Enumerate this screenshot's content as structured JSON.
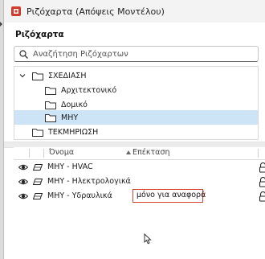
{
  "window": {
    "title": "Ριζόχαρτα (Απόψεις Μοντέλου)"
  },
  "panel": {
    "section_title": "Ριζόχαρτα"
  },
  "search": {
    "placeholder": "Αναζήτηση Ριζόχαρτων",
    "value": ""
  },
  "tree": {
    "items": [
      {
        "label": "ΣΧΕΔΙΑΣΗ",
        "expanded": true,
        "level": 0
      },
      {
        "label": "Αρχιτεκτονικό",
        "level": 1
      },
      {
        "label": "Δομικό",
        "level": 1
      },
      {
        "label": "ΜΗΥ",
        "level": 1,
        "selected": true
      },
      {
        "label": "ΤΕΚΜΗΡΙΩΣΗ",
        "level": 0
      }
    ]
  },
  "layers_table": {
    "columns": {
      "name": "Όνομα",
      "extension": "Επέκταση"
    },
    "rows": [
      {
        "name": "ΜΗΥ - HVAC",
        "extension": ""
      },
      {
        "name": "ΜΗΥ - Ηλεκτρολογικά",
        "extension": ""
      },
      {
        "name": "ΜΗΥ - Υδραυλικά",
        "extension": "μόνο για αναφορά"
      }
    ]
  },
  "icons": [
    "app-icon",
    "search-icon",
    "chevron-down-icon",
    "folder-icon",
    "eye-icon",
    "layer-icon",
    "lock-icon"
  ],
  "colors": {
    "selection": "#cde4f7",
    "edit_border": "#d9432f"
  }
}
